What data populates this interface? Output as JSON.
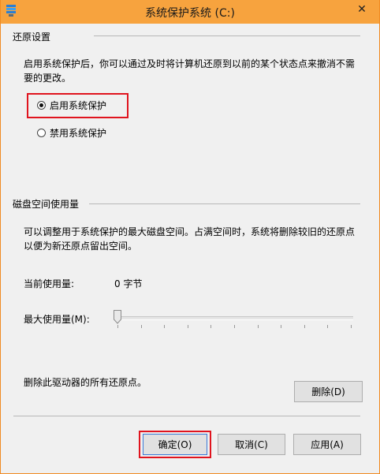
{
  "window": {
    "title": "系统保护系统 (C:)",
    "close_glyph": "✕",
    "accent_color": "#f7a33e"
  },
  "restore": {
    "group_label": "还原设置",
    "description_line1": "启用系统保护后，你可以通过及时将计算机还原到以前的某个状态点来撤消不需",
    "description_line2": "要的更改。",
    "options": [
      {
        "label": "启用系统保护",
        "checked": true
      },
      {
        "label": "禁用系统保护",
        "checked": false
      }
    ]
  },
  "disk": {
    "group_label": "磁盘空间使用量",
    "description_line1": "可以调整用于系统保护的最大磁盘空间。占满空间时，系统将删除较旧的还原点",
    "description_line2": "以便为新还原点留出空间。",
    "current_label": "当前使用量:",
    "current_value": "0 字节",
    "max_label": "最大使用量(M):",
    "slider_value_percent": 0
  },
  "delete_section": {
    "text": "删除此驱动器的所有还原点。",
    "button": "删除(D)"
  },
  "buttons": {
    "ok": "确定(O)",
    "cancel": "取消(C)",
    "apply": "应用(A)"
  }
}
